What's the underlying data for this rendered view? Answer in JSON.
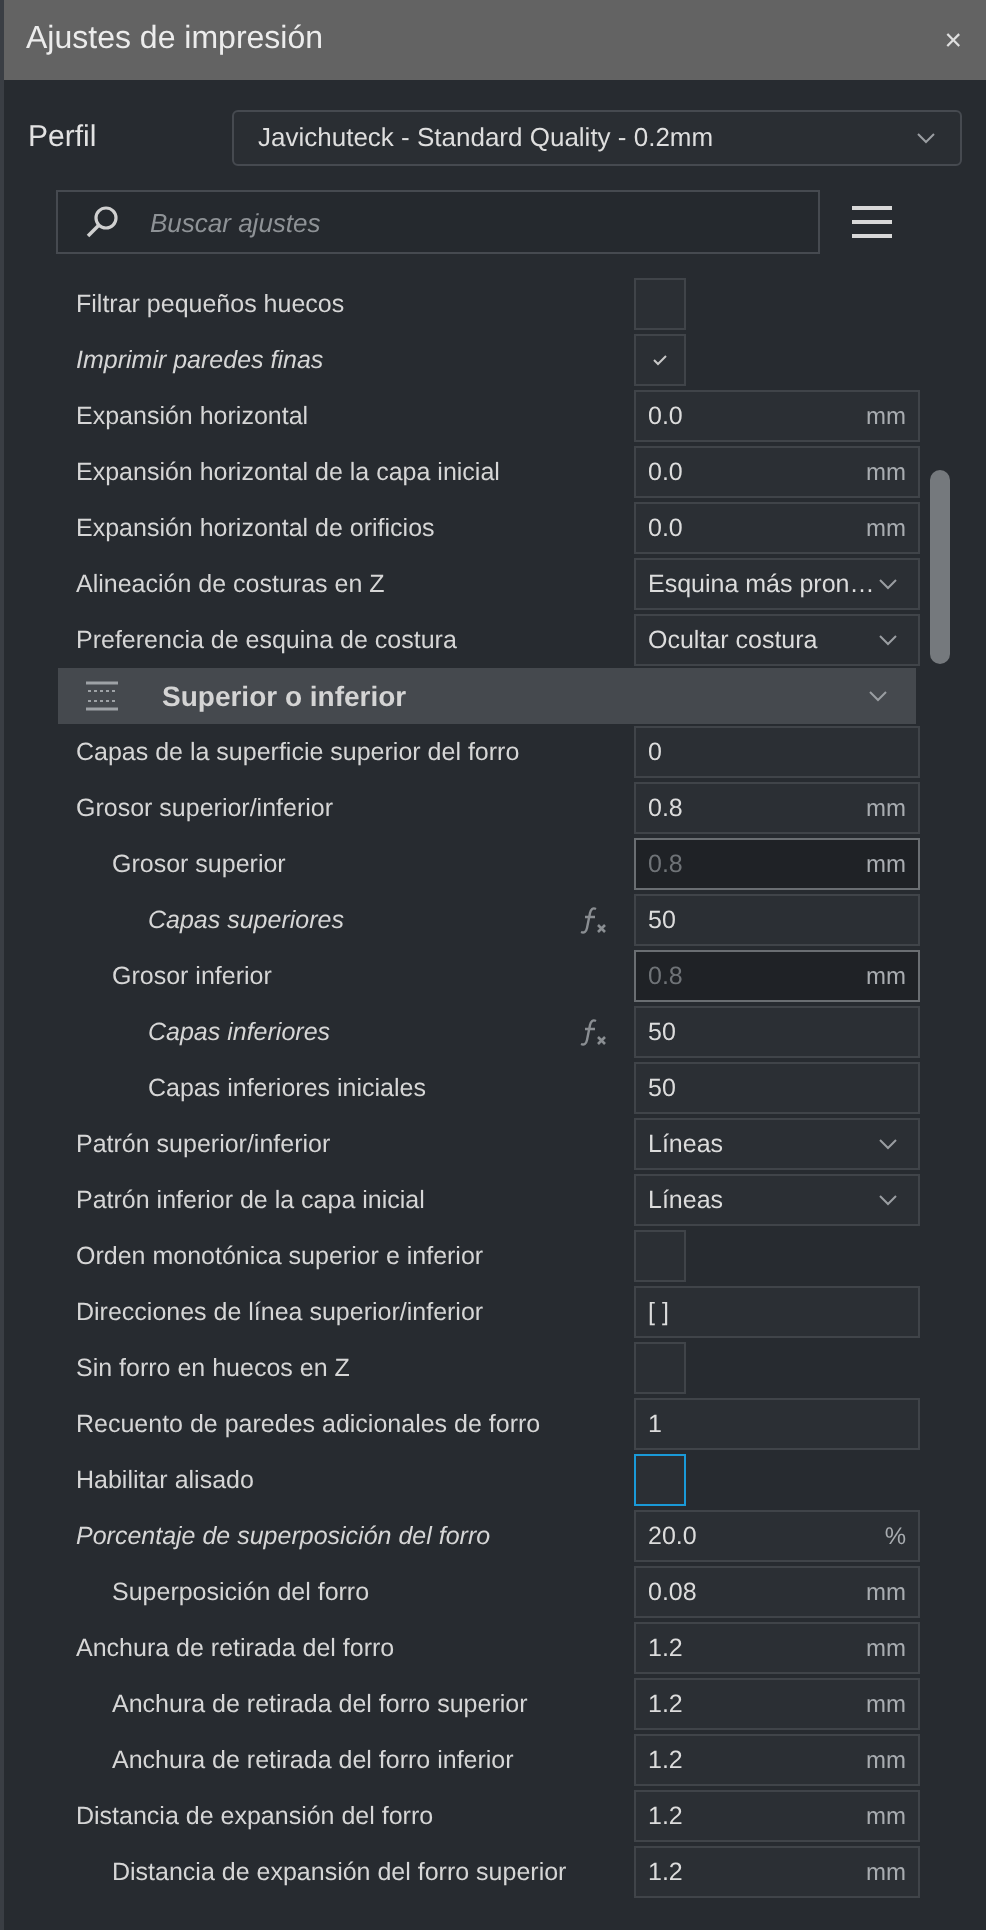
{
  "window": {
    "title": "Ajustes de impresión",
    "close": "×"
  },
  "profile": {
    "label": "Perfil",
    "value": "Javichuteck - Standard Quality - 0.2mm"
  },
  "search": {
    "placeholder": "Buscar ajustes"
  },
  "settings": [
    {
      "kind": "checkbox",
      "label": "Filtrar pequeños huecos",
      "italic": false,
      "formula": false,
      "checked": false,
      "focused": false
    },
    {
      "kind": "checkbox",
      "label": "Imprimir paredes finas",
      "italic": true,
      "formula": false,
      "checked": true,
      "focused": false
    },
    {
      "kind": "number",
      "label": "Expansión horizontal",
      "italic": false,
      "formula": false,
      "value": "0.0",
      "unit": "mm",
      "faded": false
    },
    {
      "kind": "number",
      "label": "Expansión horizontal de la capa inicial",
      "italic": false,
      "formula": false,
      "value": "0.0",
      "unit": "mm",
      "faded": false
    },
    {
      "kind": "number",
      "label": "Expansión horizontal de orificios",
      "italic": false,
      "formula": false,
      "value": "0.0",
      "unit": "mm",
      "faded": false
    },
    {
      "kind": "select",
      "label": "Alineación de costuras en Z",
      "italic": false,
      "formula": false,
      "value": "Esquina más pron…"
    },
    {
      "kind": "select",
      "label": "Preferencia de esquina de costura",
      "italic": false,
      "formula": false,
      "value": "Ocultar costura"
    },
    {
      "kind": "section",
      "label": "Superior o inferior",
      "expanded": true
    },
    {
      "kind": "number",
      "label": "Capas de la superficie superior del forro",
      "italic": false,
      "formula": false,
      "value": "0",
      "faded": false
    },
    {
      "kind": "number",
      "label": "Grosor superior/inferior",
      "italic": false,
      "formula": false,
      "value": "0.8",
      "unit": "mm",
      "faded": false,
      "children": [
        {
          "kind": "number",
          "label": "Grosor superior",
          "italic": false,
          "formula": false,
          "value": "0.8",
          "unit": "mm",
          "faded": true,
          "children": [
            {
              "kind": "number",
              "label": "Capas superiores",
              "italic": true,
              "formula": true,
              "value": "50",
              "faded": false
            }
          ]
        },
        {
          "kind": "number",
          "label": "Grosor inferior",
          "italic": false,
          "formula": false,
          "value": "0.8",
          "unit": "mm",
          "faded": true,
          "children": [
            {
              "kind": "number",
              "label": "Capas inferiores",
              "italic": true,
              "formula": true,
              "value": "50",
              "faded": false
            },
            {
              "kind": "number",
              "label": "Capas inferiores iniciales",
              "italic": false,
              "formula": false,
              "value": "50",
              "faded": false
            }
          ]
        }
      ]
    },
    {
      "kind": "select",
      "label": "Patrón superior/inferior",
      "italic": false,
      "formula": false,
      "value": "Líneas"
    },
    {
      "kind": "select",
      "label": "Patrón inferior de la capa inicial",
      "italic": false,
      "formula": false,
      "value": "Líneas"
    },
    {
      "kind": "checkbox",
      "label": "Orden monotónica superior e inferior",
      "italic": false,
      "formula": false,
      "checked": false,
      "focused": false
    },
    {
      "kind": "number",
      "label": "Direcciones de línea superior/inferior",
      "italic": false,
      "formula": false,
      "value": "[ ]",
      "faded": false
    },
    {
      "kind": "checkbox",
      "label": "Sin forro en huecos en Z",
      "italic": false,
      "formula": false,
      "checked": false,
      "focused": false
    },
    {
      "kind": "number",
      "label": "Recuento de paredes adicionales de forro",
      "italic": false,
      "formula": false,
      "value": "1",
      "faded": false
    },
    {
      "kind": "checkbox",
      "label": "Habilitar alisado",
      "italic": false,
      "formula": false,
      "checked": false,
      "focused": true
    },
    {
      "kind": "number",
      "label": "Porcentaje de superposición del forro",
      "italic": true,
      "formula": false,
      "value": "20.0",
      "unit": "%",
      "faded": false,
      "children": [
        {
          "kind": "number",
          "label": "Superposición del forro",
          "italic": false,
          "formula": false,
          "value": "0.08",
          "unit": "mm",
          "faded": false
        }
      ]
    },
    {
      "kind": "number",
      "label": "Anchura de retirada del forro",
      "italic": false,
      "formula": false,
      "value": "1.2",
      "unit": "mm",
      "faded": false,
      "children": [
        {
          "kind": "number",
          "label": "Anchura de retirada del forro superior",
          "italic": false,
          "formula": false,
          "value": "1.2",
          "unit": "mm",
          "faded": false
        },
        {
          "kind": "number",
          "label": "Anchura de retirada del forro inferior",
          "italic": false,
          "formula": false,
          "value": "1.2",
          "unit": "mm",
          "faded": false
        }
      ]
    },
    {
      "kind": "number",
      "label": "Distancia de expansión del forro",
      "italic": false,
      "formula": false,
      "value": "1.2",
      "unit": "mm",
      "faded": false,
      "children": [
        {
          "kind": "number",
          "label": "Distancia de expansión del forro superior",
          "italic": false,
          "formula": false,
          "value": "1.2",
          "unit": "mm",
          "faded": false
        }
      ]
    }
  ]
}
